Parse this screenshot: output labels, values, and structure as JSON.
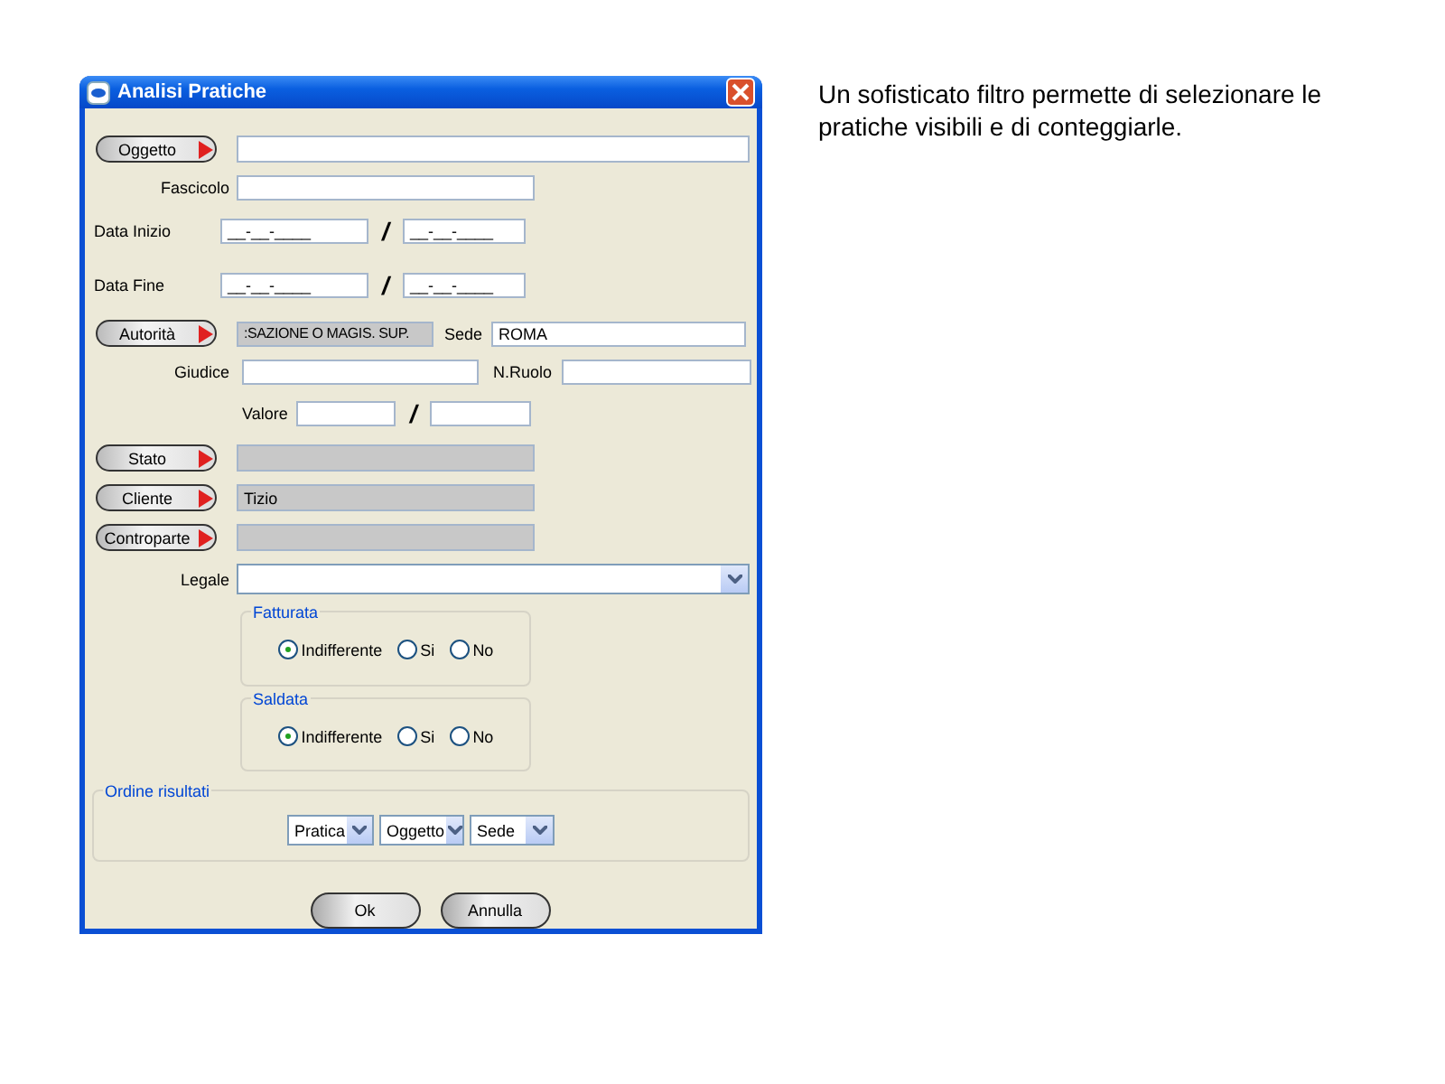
{
  "window": {
    "title": "Analisi Pratiche"
  },
  "oggetto": {
    "label": "Oggetto"
  },
  "fascicolo": {
    "label": "Fascicolo"
  },
  "date_ranges": [
    {
      "label": "Data Inizio",
      "from": "__-__-____",
      "separator": "/",
      "to": "__-__-____"
    },
    {
      "label": "Data Fine",
      "from": "__-__-____",
      "separator": "/",
      "to": "__-__-____"
    }
  ],
  "autorita": {
    "label": "Autorità",
    "value": ":SAZIONE O MAGIS. SUP."
  },
  "sede": {
    "label": "Sede",
    "value": "ROMA"
  },
  "giudice": {
    "label": "Giudice"
  },
  "n_ruolo": {
    "label": "N.Ruolo"
  },
  "valore": {
    "label": "Valore",
    "separator": "/"
  },
  "lookups": [
    {
      "label": "Stato"
    },
    {
      "label": "Cliente",
      "value": "Tizio"
    },
    {
      "label": "Controparte"
    }
  ],
  "legale": {
    "label": "Legale"
  },
  "radio_groups": [
    {
      "title": "Fatturata",
      "options": [
        {
          "label": "Indifferente",
          "selected": true
        },
        {
          "label": "Si",
          "selected": false
        },
        {
          "label": "No",
          "selected": false
        }
      ]
    },
    {
      "title": "Saldata",
      "options": [
        {
          "label": "Indifferente",
          "selected": true
        },
        {
          "label": "Si",
          "selected": false
        },
        {
          "label": "No",
          "selected": false
        }
      ]
    }
  ],
  "ordine": {
    "title": "Ordine risultati",
    "selects": [
      "Pratica",
      "Oggetto",
      "Sede"
    ]
  },
  "buttons": [
    "Ok",
    "Annulla"
  ],
  "caption": "Un sofisticato filtro permette di selezionare le pratiche visibili e di conteggiarle."
}
